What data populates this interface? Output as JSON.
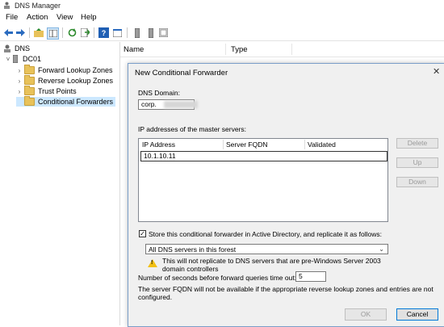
{
  "window": {
    "title": "DNS Manager"
  },
  "menu": [
    "File",
    "Action",
    "View",
    "Help"
  ],
  "toolbar": {
    "icons": [
      "back-arrow-icon",
      "forward-arrow-icon",
      "folder-up-icon",
      "show-hide-tree-icon",
      "refresh-icon",
      "export-list-icon",
      "help-icon",
      "properties-icon",
      "server-icon",
      "server-alt-icon",
      "filter-icon"
    ]
  },
  "tree": {
    "root": "DNS",
    "server": "DC01",
    "items": [
      "Forward Lookup Zones",
      "Reverse Lookup Zones",
      "Trust Points",
      "Conditional Forwarders"
    ],
    "selected_index": 3
  },
  "list": {
    "columns": [
      "Name",
      "Type"
    ]
  },
  "dialog": {
    "title": "New Conditional Forwarder",
    "close": "✕",
    "dns_domain_label": "DNS Domain:",
    "dns_domain_value": "corp.​",
    "ip_section_label": "IP addresses of the master servers:",
    "grid_columns": [
      "IP Address",
      "Server FQDN",
      "Validated"
    ],
    "ip_entry": "10.1.10.11",
    "buttons": {
      "delete": "Delete",
      "up": "Up",
      "down": "Down",
      "ok": "OK",
      "cancel": "Cancel"
    },
    "store_ad_checked": true,
    "store_ad_label": "Store this conditional forwarder in Active Directory, and replicate it as follows:",
    "replication_selected": "All DNS servers in this forest",
    "warning_line1": "This will not replicate to DNS servers that are pre-Windows Server 2003",
    "warning_line2": "domain controllers",
    "timeout_label": "Number of seconds before forward queries time out:",
    "timeout_value": "5",
    "fqdn_note_line1": "The server FQDN will not be available if the appropriate reverse lookup zones and entries are not",
    "fqdn_note_line2": "configured."
  },
  "colors": {
    "accent": "#0078d7",
    "selection": "#cce8ff",
    "folder": "#e8c25a",
    "warning": "#f2c014"
  }
}
